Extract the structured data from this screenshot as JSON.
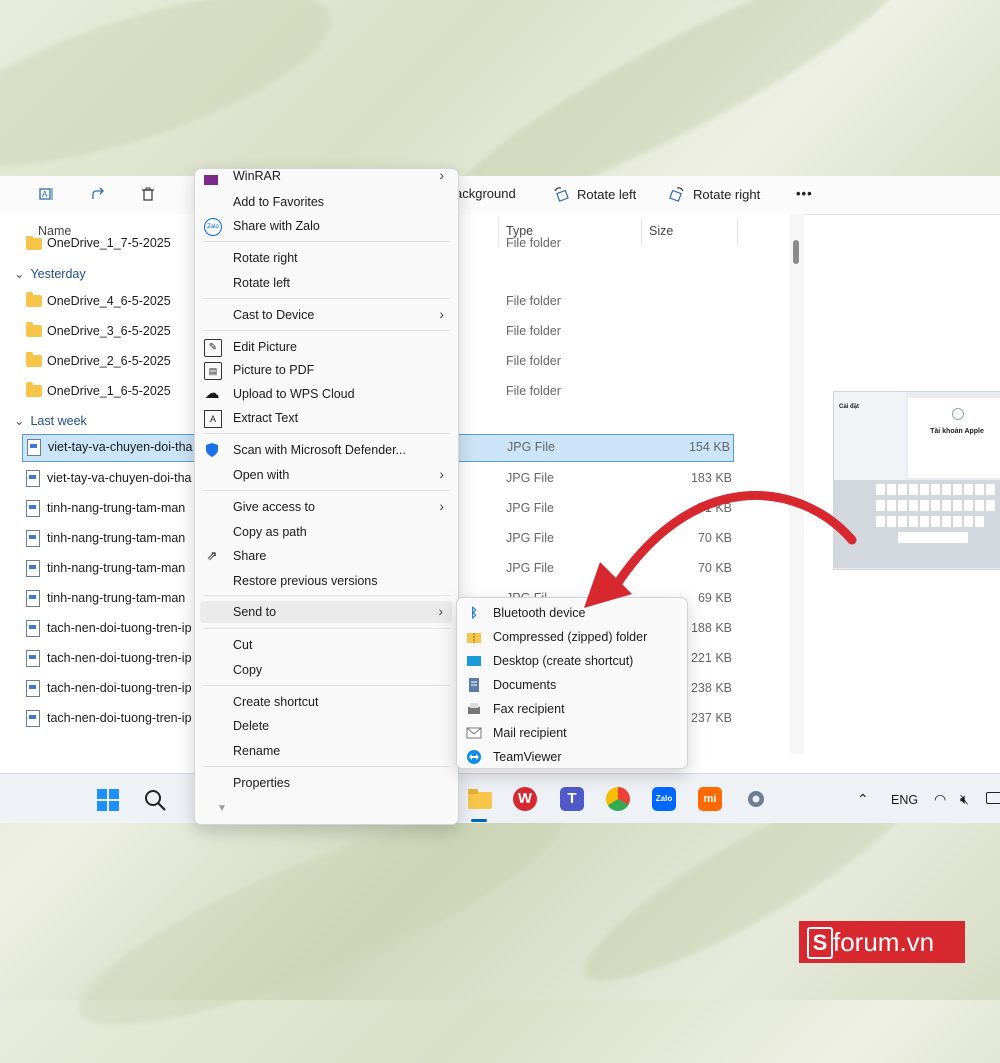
{
  "toolbar": {
    "background_label": "ackground",
    "rotate_left_label": "Rotate left",
    "rotate_right_label": "Rotate right",
    "more_label": "•••"
  },
  "columns": {
    "name": "Name",
    "type": "Type",
    "size": "Size"
  },
  "groups": {
    "yesterday": "Yesterday",
    "last_week": "Last week"
  },
  "rows": [
    {
      "name": "OneDrive_1_7-5-2025",
      "type": "File folder",
      "size": ""
    },
    {
      "name": "OneDrive_4_6-5-2025",
      "type": "File folder",
      "size": ""
    },
    {
      "name": "OneDrive_3_6-5-2025",
      "type": "File folder",
      "size": ""
    },
    {
      "name": "OneDrive_2_6-5-2025",
      "type": "File folder",
      "size": ""
    },
    {
      "name": "OneDrive_1_6-5-2025",
      "type": "File folder",
      "size": ""
    },
    {
      "name": "viet-tay-va-chuyen-doi-tha",
      "type": "JPG File",
      "size": "154 KB"
    },
    {
      "name": "viet-tay-va-chuyen-doi-tha",
      "type": "JPG File",
      "size": "183 KB"
    },
    {
      "name": "tinh-nang-trung-tam-man",
      "type": "JPG File",
      "size": "71 KB"
    },
    {
      "name": "tinh-nang-trung-tam-man",
      "type": "JPG File",
      "size": "70 KB"
    },
    {
      "name": "tinh-nang-trung-tam-man",
      "type": "JPG File",
      "size": "70 KB"
    },
    {
      "name": "tinh-nang-trung-tam-man",
      "type": "JPG Fil",
      "size": "69 KB"
    },
    {
      "name": "tach-nen-doi-tuong-tren-ip",
      "type": "",
      "size": "188 KB"
    },
    {
      "name": "tach-nen-doi-tuong-tren-ip",
      "type": "",
      "size": "221 KB"
    },
    {
      "name": "tach-nen-doi-tuong-tren-ip",
      "type": "",
      "size": "238 KB"
    },
    {
      "name": "tach-nen-doi-tuong-tren-ip",
      "type": "",
      "size": "237 KB"
    }
  ],
  "context_menu": {
    "winrar": "WinRAR",
    "add_favorites": "Add to Favorites",
    "share_zalo": "Share with Zalo",
    "rotate_right": "Rotate right",
    "rotate_left": "Rotate left",
    "cast": "Cast to Device",
    "edit_picture": "Edit Picture",
    "picture_pdf": "Picture to PDF",
    "upload_wps": "Upload to WPS Cloud",
    "extract_text": "Extract Text",
    "scan_defender": "Scan with Microsoft Defender...",
    "open_with": "Open with",
    "give_access": "Give access to",
    "copy_path": "Copy as path",
    "share": "Share",
    "restore": "Restore previous versions",
    "send_to": "Send to",
    "cut": "Cut",
    "copy": "Copy",
    "create_shortcut": "Create shortcut",
    "delete": "Delete",
    "rename": "Rename",
    "properties": "Properties"
  },
  "send_to_menu": {
    "bluetooth": "Bluetooth device",
    "zip": "Compressed (zipped) folder",
    "desktop": "Desktop (create shortcut)",
    "documents": "Documents",
    "fax": "Fax recipient",
    "mail": "Mail recipient",
    "teamviewer": "TeamViewer"
  },
  "preview": {
    "heading": "Tài khoản Apple",
    "settings": "Cài đặt"
  },
  "taskbar": {
    "lang": "ENG",
    "wps": "W",
    "zalo": "Zalo",
    "mi": "mi"
  },
  "brand": {
    "logo": "S",
    "text": "forum.vn"
  },
  "colors": {
    "accent": "#0067c0",
    "arrow": "#d7282f",
    "brand": "#d7282f"
  }
}
